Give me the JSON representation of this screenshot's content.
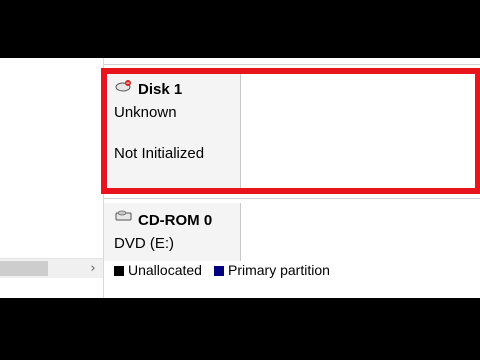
{
  "disks": [
    {
      "name": "Disk 1",
      "type": "Unknown",
      "status": "Not Initialized",
      "icon": "disk-unknown-icon"
    },
    {
      "name": "CD-ROM 0",
      "type": "DVD (E:)",
      "icon": "cdrom-icon"
    }
  ],
  "legend": [
    {
      "label": "Unallocated",
      "color": "#000000"
    },
    {
      "label": "Primary partition",
      "color": "#000080"
    }
  ],
  "scrollbar": {
    "right_arrow": "›"
  },
  "colors": {
    "highlight": "#e8141c"
  }
}
